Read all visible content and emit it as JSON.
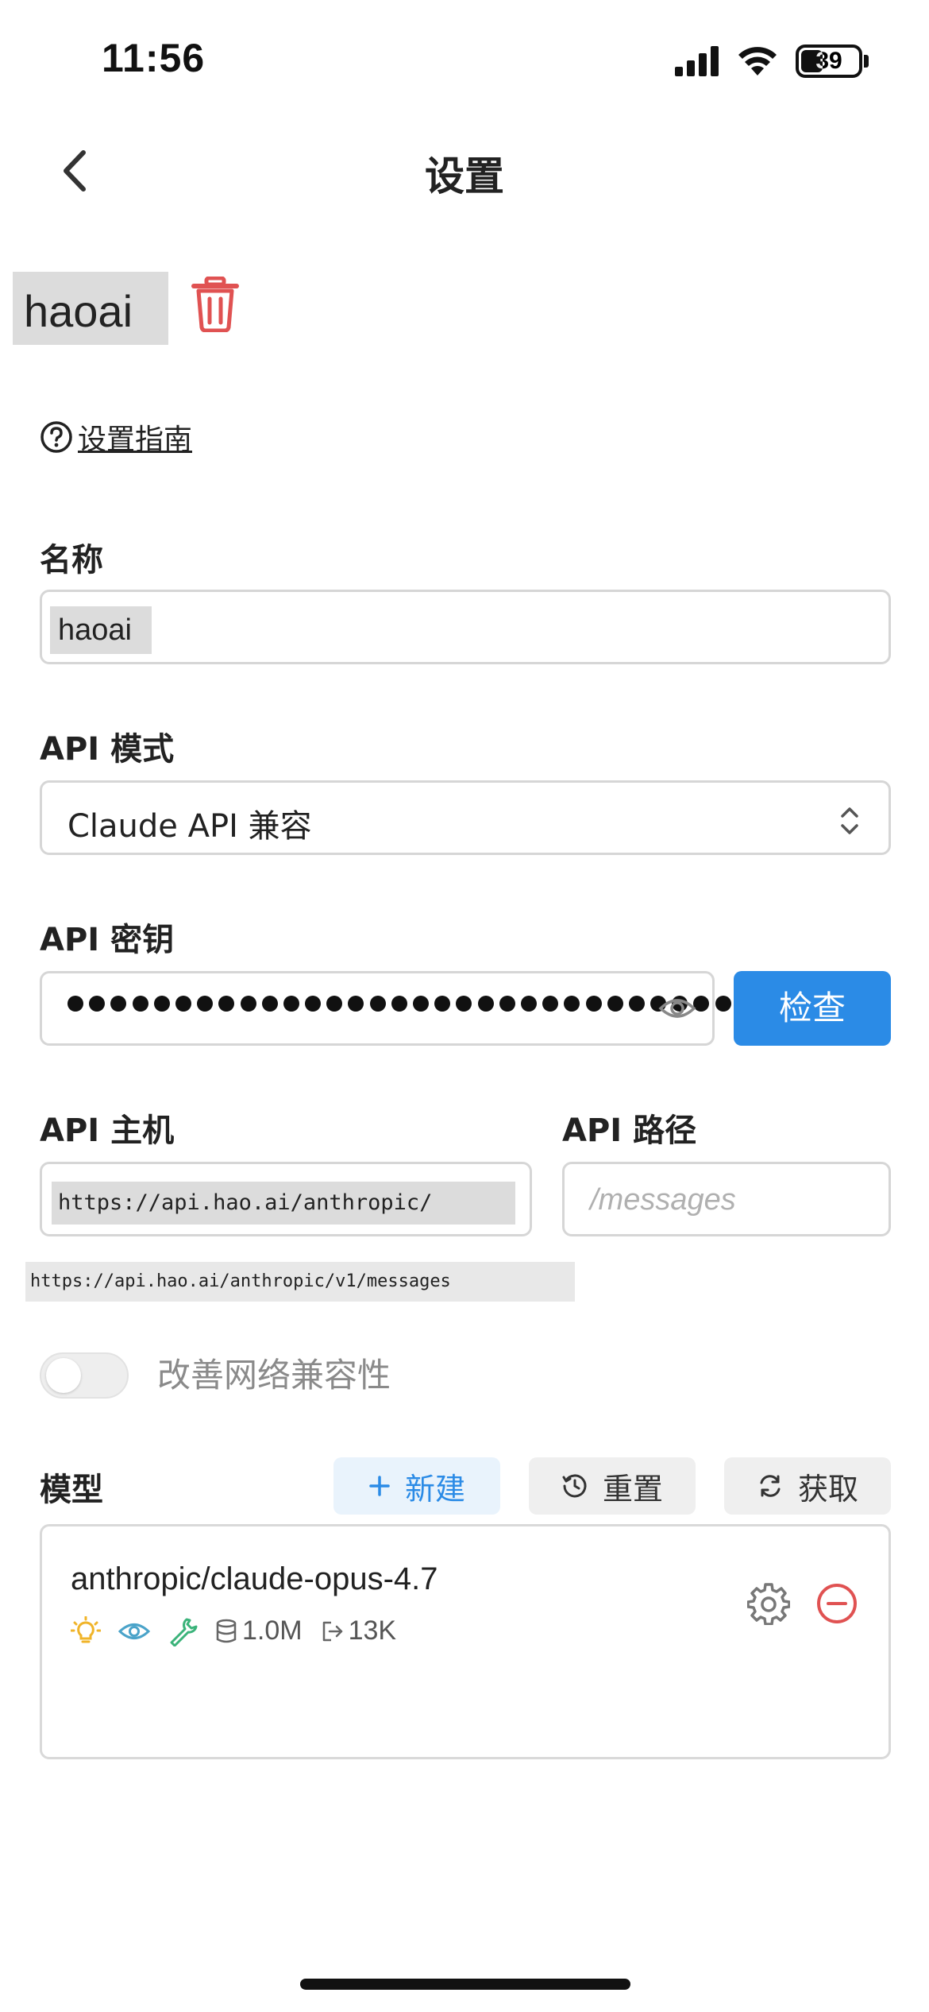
{
  "status_bar": {
    "time": "11:56",
    "battery": "39"
  },
  "nav": {
    "title": "设置"
  },
  "provider": {
    "name": "haoai"
  },
  "guide": {
    "label": "设置指南"
  },
  "form": {
    "name_label": "名称",
    "name_value": "haoai",
    "mode_label": "API 模式",
    "mode_value": "Claude API 兼容",
    "key_label": "API 密钥",
    "key_masked_length": 31,
    "check_button": "检查",
    "host_label": "API 主机",
    "host_value": "https://api.hao.ai/anthropic/",
    "path_label": "API 路径",
    "path_placeholder": "/messages",
    "preview_url": "https://api.hao.ai/anthropic/v1/messages",
    "compat_toggle_label": "改善网络兼容性",
    "compat_toggle_on": false
  },
  "models": {
    "label": "模型",
    "new_button": "新建",
    "reset_button": "重置",
    "fetch_button": "获取",
    "items": [
      {
        "name": "anthropic/claude-opus-4.7",
        "context": "1.0M",
        "max_output": "13K",
        "capabilities": [
          "reasoning-bulb-icon",
          "vision-eye-icon",
          "tool-wrench-icon"
        ]
      }
    ]
  },
  "colors": {
    "accent": "#2b8be6",
    "danger": "#e05252",
    "bulb": "#f0b429",
    "eye": "#4aa3c9",
    "wrench": "#3bb37a"
  }
}
